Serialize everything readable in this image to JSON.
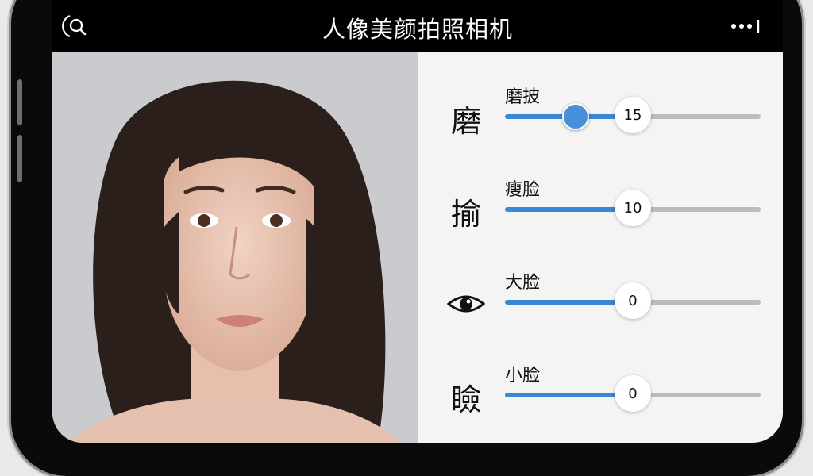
{
  "header": {
    "title": "人像美颜拍照相机",
    "search_icon": "search-icon",
    "more_icon": "more-icon"
  },
  "photo": {
    "subject": "portrait"
  },
  "adjustments": [
    {
      "icon_text": "磨",
      "label": "磨披",
      "value": "15",
      "knob_level": 0.27,
      "bubble_level": 0.5
    },
    {
      "icon_text": "揄",
      "label": "瘦脸",
      "value": "10",
      "bubble_level": 0.5
    },
    {
      "icon_text": "",
      "icon": "eye-icon",
      "label": "大脸",
      "value": "0",
      "bubble_level": 0.5
    },
    {
      "icon_text": "瞼",
      "label": "小脸",
      "value": "0",
      "bubble_level": 0.5
    }
  ],
  "colors": {
    "accent": "#3c86d6",
    "track": "#bcbcbc",
    "panel_bg": "#f4f4f4",
    "header_bg": "#000000"
  }
}
